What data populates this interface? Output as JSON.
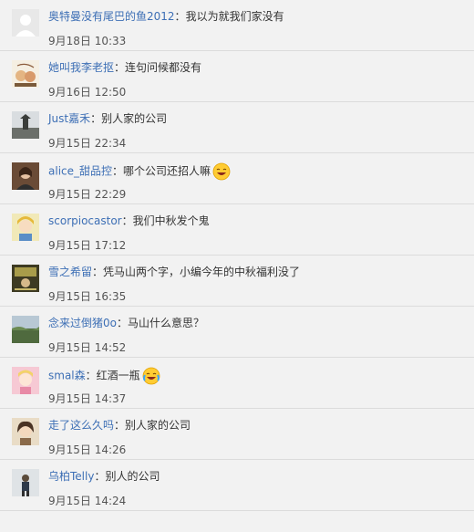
{
  "comments": [
    {
      "user": "奥特曼没有尾巴的鱼2012",
      "text": "我以为就我们家没有",
      "time": "9月18日 10:33",
      "avatar": "default-avatar-icon"
    },
    {
      "user": "她叫我李老抠",
      "text": "连句问候都没有",
      "time": "9月16日 12:50",
      "avatar": "cartoon-avatar-icon"
    },
    {
      "user": "Just嘉禾",
      "text": "别人家的公司",
      "time": "9月15日 22:34",
      "avatar": "landscape-avatar-icon"
    },
    {
      "user": "alice_甜品控",
      "text": "哪个公司还招人嘛",
      "time": "9月15日 22:29",
      "avatar": "photo-avatar-icon",
      "emoji": "laughing-emoji-icon"
    },
    {
      "user": "scorpiocastor",
      "text": "我们中秋发个鬼",
      "time": "9月15日 17:12",
      "avatar": "anime-avatar-icon"
    },
    {
      "user": "雪之希留",
      "text": "凭马山两个字，小编今年的中秋福利没了",
      "time": "9月15日 16:35",
      "avatar": "poster-avatar-icon"
    },
    {
      "user": "念来过倒猪0o",
      "text": "马山什么意思？",
      "time": "9月15日 14:52",
      "avatar": "field-avatar-icon"
    },
    {
      "user": "smal森",
      "text": "红酒一瓶",
      "time": "9月15日 14:37",
      "avatar": "pink-avatar-icon",
      "emoji": "crying-laughing-emoji-icon"
    },
    {
      "user": "走了这么久吗",
      "text": "别人家的公司",
      "time": "9月15日 14:26",
      "avatar": "girl-avatar-icon"
    },
    {
      "user": "乌柏Telly",
      "text": "别人的公司",
      "time": "9月15日 14:24",
      "avatar": "person-avatar-icon"
    }
  ],
  "separator": "："
}
